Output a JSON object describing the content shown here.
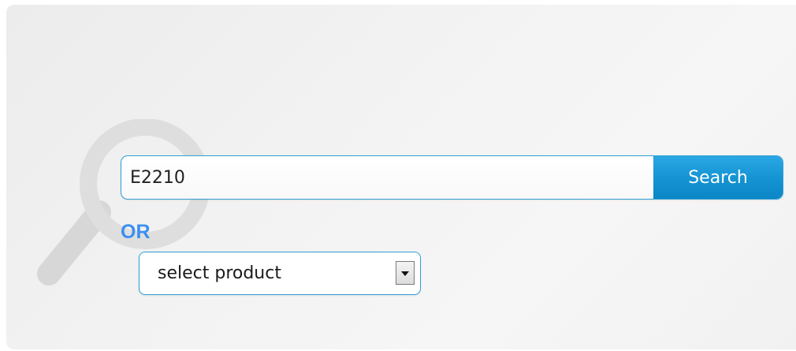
{
  "search": {
    "value": "E2210",
    "button_label": "Search"
  },
  "separator": {
    "label": "OR"
  },
  "product_select": {
    "selected": "select product"
  },
  "icons": {
    "background": "magnifier-icon",
    "dropdown": "chevron-down-icon"
  },
  "colors": {
    "accent": "#1493d2",
    "or_label": "#3c8ff0",
    "border": "#2f9fd2"
  }
}
